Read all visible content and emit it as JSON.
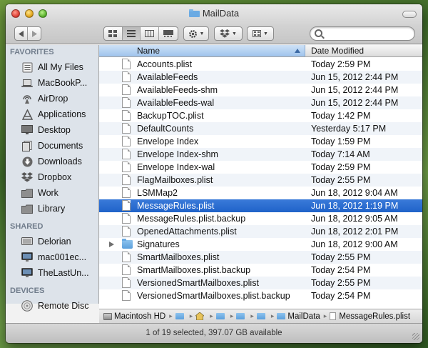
{
  "window": {
    "title": "MailData"
  },
  "toolbar": {
    "search_placeholder": "",
    "view_modes": [
      "icon-view",
      "list-view",
      "column-view",
      "cover-flow-view"
    ],
    "active_view": "list-view"
  },
  "sidebar": {
    "favorites_label": "FAVORITES",
    "favorites": [
      {
        "label": "All My Files",
        "icon": "all-files-icon"
      },
      {
        "label": "MacBookP...",
        "icon": "laptop-icon"
      },
      {
        "label": "AirDrop",
        "icon": "airdrop-icon"
      },
      {
        "label": "Applications",
        "icon": "applications-icon"
      },
      {
        "label": "Desktop",
        "icon": "desktop-icon"
      },
      {
        "label": "Documents",
        "icon": "documents-icon"
      },
      {
        "label": "Downloads",
        "icon": "downloads-icon"
      },
      {
        "label": "Dropbox",
        "icon": "dropbox-icon"
      },
      {
        "label": "Work",
        "icon": "folder-icon"
      },
      {
        "label": "Library",
        "icon": "folder-icon"
      }
    ],
    "shared_label": "SHARED",
    "shared": [
      {
        "label": "Delorian",
        "icon": "server-icon"
      },
      {
        "label": "mac001ec...",
        "icon": "computer-icon"
      },
      {
        "label": "TheLastUn...",
        "icon": "computer-icon"
      }
    ],
    "devices_label": "DEVICES",
    "devices": [
      {
        "label": "Remote Disc",
        "icon": "disc-icon"
      }
    ]
  },
  "filelist": {
    "col_name": "Name",
    "col_date": "Date Modified",
    "rows": [
      {
        "name": "Accounts.plist",
        "date": "Today 2:59 PM",
        "kind": "file"
      },
      {
        "name": "AvailableFeeds",
        "date": "Jun 15, 2012 2:44 PM",
        "kind": "file"
      },
      {
        "name": "AvailableFeeds-shm",
        "date": "Jun 15, 2012 2:44 PM",
        "kind": "file"
      },
      {
        "name": "AvailableFeeds-wal",
        "date": "Jun 15, 2012 2:44 PM",
        "kind": "file"
      },
      {
        "name": "BackupTOC.plist",
        "date": "Today 1:42 PM",
        "kind": "file"
      },
      {
        "name": "DefaultCounts",
        "date": "Yesterday 5:17 PM",
        "kind": "file"
      },
      {
        "name": "Envelope Index",
        "date": "Today 1:59 PM",
        "kind": "file"
      },
      {
        "name": "Envelope Index-shm",
        "date": "Today 7:14 AM",
        "kind": "file"
      },
      {
        "name": "Envelope Index-wal",
        "date": "Today 2:59 PM",
        "kind": "file"
      },
      {
        "name": "FlagMailboxes.plist",
        "date": "Today 2:55 PM",
        "kind": "file"
      },
      {
        "name": "LSMMap2",
        "date": "Jun 18, 2012 9:04 AM",
        "kind": "file"
      },
      {
        "name": "MessageRules.plist",
        "date": "Jun 18, 2012 1:19 PM",
        "kind": "file",
        "selected": true
      },
      {
        "name": "MessageRules.plist.backup",
        "date": "Jun 18, 2012 9:05 AM",
        "kind": "file"
      },
      {
        "name": "OpenedAttachments.plist",
        "date": "Jun 18, 2012 2:01 PM",
        "kind": "file"
      },
      {
        "name": "Signatures",
        "date": "Jun 18, 2012 9:00 AM",
        "kind": "folder"
      },
      {
        "name": "SmartMailboxes.plist",
        "date": "Today 2:55 PM",
        "kind": "file"
      },
      {
        "name": "SmartMailboxes.plist.backup",
        "date": "Today 2:54 PM",
        "kind": "file"
      },
      {
        "name": "VersionedSmartMailboxes.plist",
        "date": "Today 2:55 PM",
        "kind": "file"
      },
      {
        "name": "VersionedSmartMailboxes.plist.backup",
        "date": "Today 2:54 PM",
        "kind": "file"
      }
    ]
  },
  "pathbar": {
    "segments": [
      {
        "label": "Macintosh HD",
        "icon": "disk-icon"
      },
      {
        "label": "",
        "icon": "folder-icon"
      },
      {
        "label": "",
        "icon": "home-icon"
      },
      {
        "label": "",
        "icon": "folder-icon"
      },
      {
        "label": "",
        "icon": "folder-icon"
      },
      {
        "label": "",
        "icon": "folder-icon"
      },
      {
        "label": "MailData",
        "icon": "folder-icon"
      },
      {
        "label": "MessageRules.plist",
        "icon": "document-icon"
      }
    ]
  },
  "status": {
    "text": "1 of 19 selected, 397.07 GB available"
  }
}
